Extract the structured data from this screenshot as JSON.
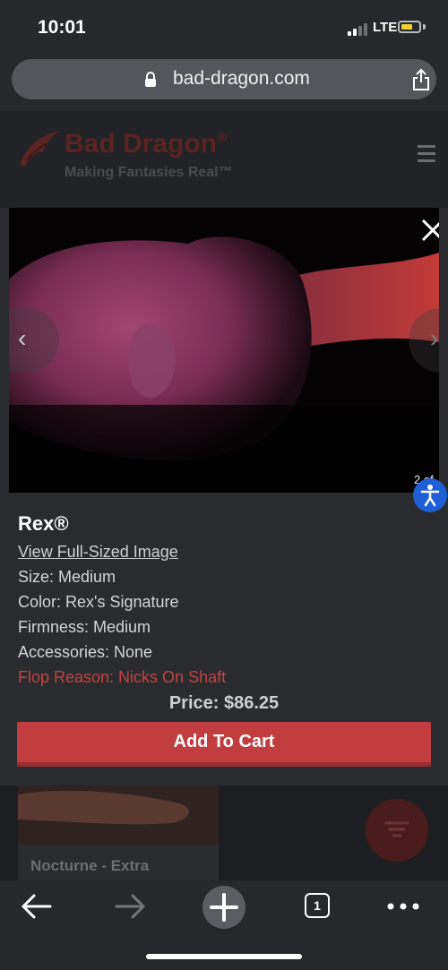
{
  "status_bar": {
    "time": "10:01",
    "network": "LTE"
  },
  "browser": {
    "url": "bad-dragon.com",
    "open_tabs": "1"
  },
  "site": {
    "brand": "Bad Dragon",
    "registered_mark": "®",
    "tagline": "Making Fantasies Real™"
  },
  "gallery": {
    "counter": "2 of 3",
    "prev_glyph": "‹",
    "next_glyph": "›"
  },
  "product": {
    "name": "Rex®",
    "view_full_link": "View Full-Sized Image",
    "details": [
      "Size: Medium",
      "Color: Rex's Signature",
      "Firmness: Medium",
      "Accessories: None"
    ],
    "flop_reason": "Flop Reason: Nicks On Shaft",
    "price": "Price: $86.25",
    "add_to_cart_label": "Add To Cart"
  },
  "listing": {
    "next_item_title": "Nocturne - Extra"
  },
  "colors": {
    "accent_red": "#c23d3f",
    "flop_red": "#c2433f",
    "accessibility_blue": "#1f5fd6"
  },
  "icons": [
    "lock-icon",
    "share-icon",
    "menu-icon",
    "close-icon",
    "accessibility-icon",
    "filter-icon",
    "back-arrow-icon",
    "forward-arrow-icon",
    "plus-icon",
    "more-icon"
  ]
}
